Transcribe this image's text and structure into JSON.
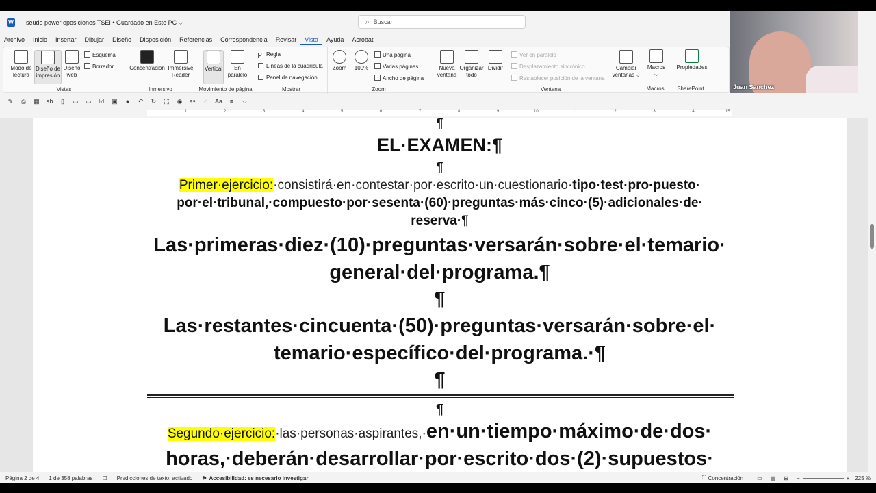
{
  "window": {
    "doc_title": "seudo power oposiciones TSEI • Guardado en Este PC ⌵",
    "search_placeholder": "Buscar"
  },
  "menu": [
    "Archivo",
    "Inicio",
    "Insertar",
    "Dibujar",
    "Diseño",
    "Disposición",
    "Referencias",
    "Correspondencia",
    "Revisar",
    "Vista",
    "Ayuda",
    "Acrobat"
  ],
  "menu_active": "Vista",
  "ribbon": {
    "vistas": {
      "label": "Vistas",
      "modo_lectura": "Modo de lectura",
      "diseno_impresion": "Diseño de impresión",
      "diseno_web": "Diseño web",
      "esquema": "Esquema",
      "borrador": "Borrador"
    },
    "inmersivo": {
      "label": "Inmersivo",
      "concentracion": "Concentración",
      "immersive_reader": "Immersive Reader"
    },
    "movimiento": {
      "label": "Movimiento de página",
      "vertical": "Vertical",
      "en_paralelo": "En paralelo"
    },
    "mostrar": {
      "label": "Mostrar",
      "regla": "Regla",
      "lineas_cuadricula": "Líneas de la cuadrícula",
      "panel_navegacion": "Panel de navegación"
    },
    "zoom": {
      "label": "Zoom",
      "zoom": "Zoom",
      "cien": "100%",
      "una_pagina": "Una página",
      "varias_paginas": "Varias páginas",
      "ancho_pagina": "Ancho de página"
    },
    "ventana": {
      "label": "Ventana",
      "nueva_ventana": "Nueva ventana",
      "organizar_todo": "Organizar todo",
      "dividir": "Dividir",
      "ver_paralelo": "Ver en paralelo",
      "desplazamiento": "Desplazamiento sincrónico",
      "restablecer": "Restablecer posición de la ventana",
      "cambiar_ventanas": "Cambiar ventanas ⌵"
    },
    "macros": {
      "label": "Macros",
      "macros": "Macros ⌵"
    },
    "sharepoint": {
      "label": "SharePoint",
      "propiedades": "Propiedades"
    }
  },
  "ruler_ticks": [
    "1",
    "2",
    "3",
    "4",
    "5",
    "6",
    "7",
    "8",
    "9",
    "10",
    "11",
    "12",
    "13",
    "14",
    "15"
  ],
  "document": {
    "pilcrow": "¶",
    "heading": "EL·EXAMEN:¶",
    "p1_highlight": "Primer·ejercicio:",
    "p1_normal": "·consistirá·en·contestar·por·escrito·un·cuestionario·",
    "p1_bold": "tipo·test·pro·puesto·",
    "p1_line2": "por·el·tribunal,·compuesto·por·sesenta·(60)·preguntas·más·cinco·(5)·adicionales·de·",
    "p1_line3": "reserva·¶",
    "p2_line1": "Las·primeras·diez·(10)·preguntas·versarán·sobre·el·temario·",
    "p2_line2": "general·del·programa.¶",
    "p3_line1": "Las·restantes·cincuenta·(50)·preguntas·versarán·sobre·el·",
    "p3_line2": "temario·específico·del·programa.·¶",
    "p4_highlight": "Segundo·ejercicio:",
    "p4_normal": "·las·personas·aspirantes,·",
    "p4_bold": "en·un·tiempo·máximo·de·dos·",
    "p4_line2": "horas,·deberán·desarrollar·por·escrito·dos·(2)·supuestos·"
  },
  "status": {
    "page": "Página 2 de 4",
    "words": "1 de 358 palabras",
    "predicciones": "Predicciones de texto: activado",
    "accesibilidad": "Accesibilidad: es necesario investigar",
    "concentracion": "Concentración",
    "zoom": "225 %"
  },
  "webcam": {
    "name": "Juan Sánchez"
  },
  "colors": {
    "highlight": "#ffff00",
    "accent": "#185abd"
  }
}
